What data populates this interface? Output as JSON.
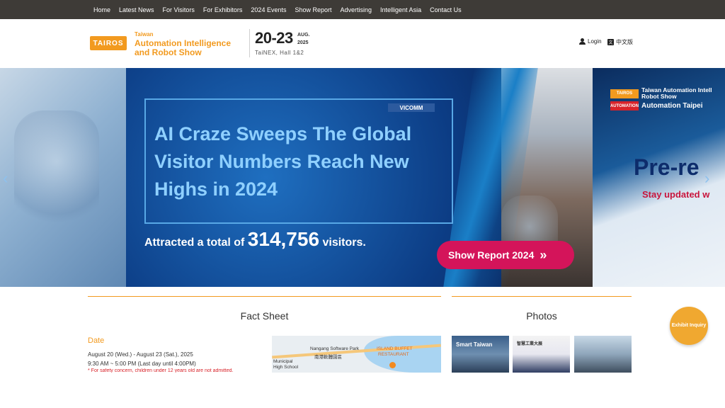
{
  "nav": {
    "items": [
      "Home",
      "Latest News",
      "For Visitors",
      "For Exhibitors",
      "2024 Events",
      "Show Report",
      "Advertising",
      "Intelligent Asia",
      "Contact Us"
    ]
  },
  "header": {
    "logo_badge": "TAIROS",
    "logo_line1": "Taiwan",
    "logo_line2": "Automation Intelligence",
    "logo_line3": "and Robot Show",
    "dates": "20-23",
    "month": "AUG.",
    "year": "2025",
    "venue": "TaiNEX, Hall 1&2",
    "login_label": "Login",
    "lang_label": "中文版",
    "lang_icon_glyph": "文"
  },
  "banner": {
    "headline": "AI Craze Sweeps The Global Visitor Numbers Reach New Highs in 2024",
    "attract_prefix": "Attracted a total of",
    "attract_number": "314,756",
    "attract_suffix": "visitors.",
    "cta_label": "Show Report 2024",
    "cta_arrows": "»",
    "crowd_sign": "VICOMM",
    "right_badge1": "TAIROS",
    "right_text1": "Taiwan Automation Intell",
    "right_text1b": "Robot Show",
    "right_badge2": "AUTOMATION",
    "right_text2": "Automation Taipei",
    "pre_reg": "Pre-re",
    "stay_updated": "Stay updated w",
    "prev_arrow": "‹",
    "next_arrow": "›"
  },
  "fact_sheet": {
    "title": "Fact Sheet",
    "date_label": "Date",
    "date_range": "August 20 (Wed.) - August 23 (Sat.), 2025",
    "time": "9:30 AM ~ 5:00 PM (Last day until 4:00PM)",
    "note": "* For safety concern, children under 12 years old are not admitted.",
    "map_labels": {
      "park": "Nangang Software Park",
      "park_zh": "南港軟體園區",
      "school": "Municipal",
      "school2": "High School",
      "restaurant": "ISLAND BUFFET",
      "restaurant2": "RESTAURANT"
    }
  },
  "photos": {
    "title": "Photos",
    "cap1": "Smart Taiwan",
    "cap2": "智慧工業大展"
  },
  "inquiry": {
    "label": "Exhibit Inquiry"
  }
}
